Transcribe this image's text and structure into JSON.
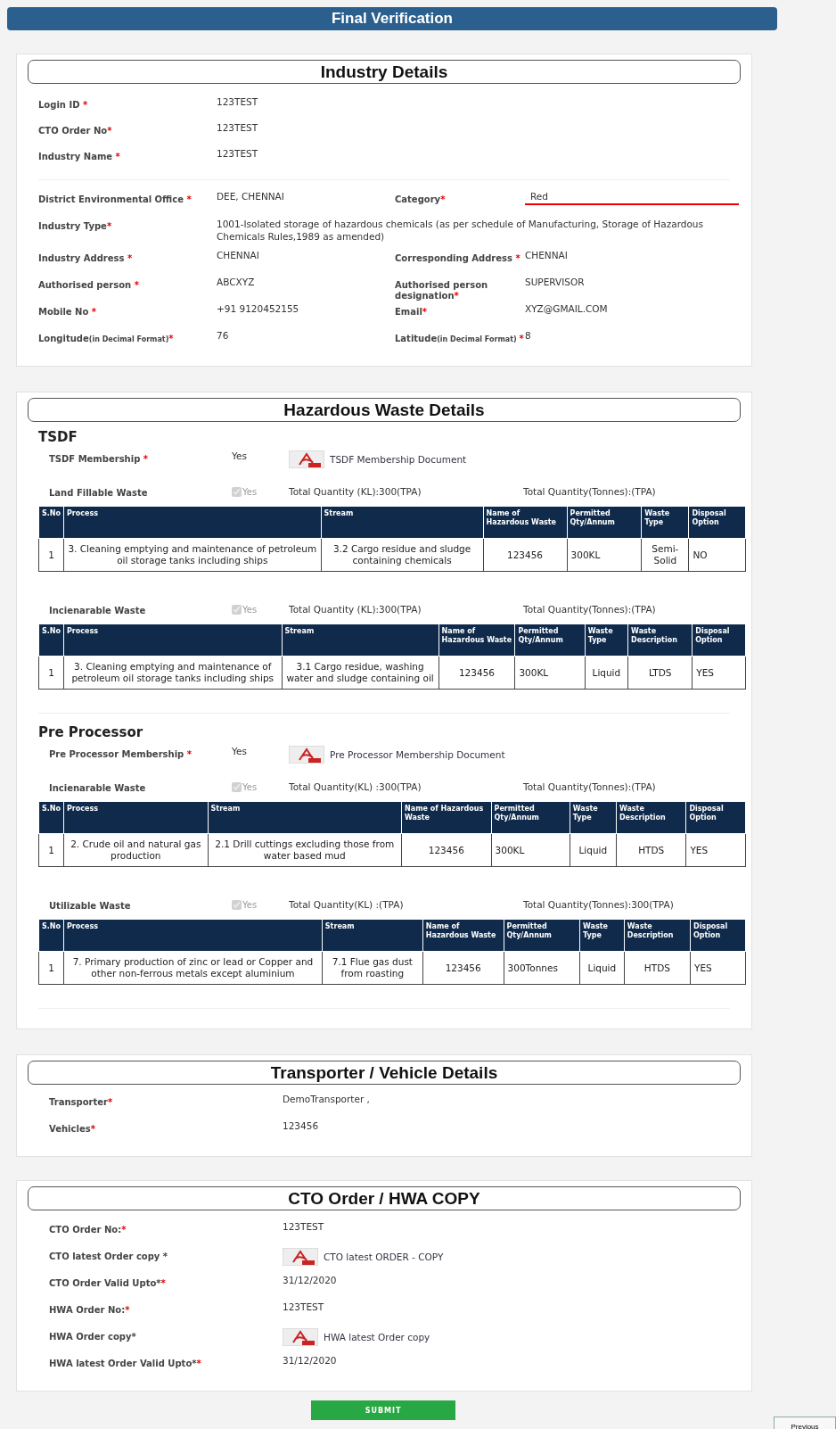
{
  "title": "Final Verification",
  "industry": {
    "title": "Industry Details",
    "top_fields": [
      {
        "label": "Login ID ",
        "mark": "*",
        "value": "123TEST"
      },
      {
        "label": "CTO Order No",
        "mark": "*",
        "value": "123TEST"
      },
      {
        "label": "Industry Name ",
        "mark": "*",
        "value": "123TEST"
      }
    ],
    "rows": [
      {
        "fields": [
          {
            "label": "District Environmental Office ",
            "mark": "*",
            "value": "DEE, CHENNAI",
            "kind": "text"
          },
          {
            "label": "Category",
            "mark": "*",
            "value": "Red",
            "kind": "underlined"
          }
        ]
      },
      {
        "fields": [
          {
            "label": "Industry Type",
            "mark": "*",
            "value": "1001-Isolated storage of hazardous chemicals (as per schedule of Manufacturing, Storage of Hazardous Chemicals Rules,1989 as amended)",
            "kind": "wide"
          }
        ]
      },
      {
        "fields": [
          {
            "label": "Industry Address ",
            "mark": "*",
            "value": "CHENNAI",
            "kind": "text"
          },
          {
            "label": "Corresponding Address ",
            "mark": "*",
            "value": "CHENNAI",
            "kind": "text"
          }
        ]
      },
      {
        "fields": [
          {
            "label": "Authorised person ",
            "mark": "*",
            "value": "ABCXYZ",
            "kind": "text"
          },
          {
            "label": "Authorised person designation",
            "mark": "*",
            "value": "SUPERVISOR",
            "kind": "text"
          }
        ]
      },
      {
        "fields": [
          {
            "label": "Mobile No ",
            "mark": "*",
            "value": "+91 9120452155",
            "kind": "text"
          },
          {
            "label": "Email",
            "mark": "*",
            "value": "XYZ@GMAIL.COM",
            "kind": "text"
          }
        ]
      },
      {
        "fields": [
          {
            "label": "Longitude",
            "note": "(in Decimal Format)",
            "mark": "*",
            "value": "76",
            "kind": "text"
          },
          {
            "label": "Latitude",
            "note": "(in Decimal Format) ",
            "mark": "*",
            "value": "8",
            "kind": "text"
          }
        ]
      }
    ]
  },
  "hazardous": {
    "title": "Hazardous Waste Details",
    "groups": [
      {
        "heading": "TSDF",
        "membership": {
          "label": "TSDF Membership ",
          "mark": "*",
          "value": "Yes",
          "document": "TSDF Membership Document"
        },
        "wastes": [
          {
            "label": "Land Fillable Waste",
            "checked": true,
            "check_label": "Yes",
            "qty_kl": "Total Quantity (KL):300(TPA)",
            "qty_tonnes": "Total Quantity(Tonnes):(TPA)",
            "columns": [
              "S.No",
              "Process",
              "Stream",
              "Name of Hazardous Waste",
              "Permitted Qty/Annum",
              "Waste Type",
              "Disposal Option"
            ],
            "rows": [
              [
                "1",
                "3. Cleaning emptying and maintenance of petroleum oil storage tanks including ships",
                "3.2 Cargo residue and sludge containing chemicals",
                "123456",
                "300KL",
                "Semi-Solid",
                "NO"
              ]
            ]
          },
          {
            "label": "Incienarable Waste",
            "checked": true,
            "check_label": "Yes",
            "qty_kl": "Total Quantity (KL):300(TPA)",
            "qty_tonnes": "Total Quantity(Tonnes):(TPA)",
            "columns": [
              "S.No",
              "Process",
              "Stream",
              "Name of Hazardous Waste",
              "Permitted Qty/Annum",
              "Waste Type",
              "Waste Description",
              "Disposal Option"
            ],
            "rows": [
              [
                "1",
                "3. Cleaning emptying and maintenance of petroleum oil storage tanks including ships",
                "3.1 Cargo residue, washing water and sludge containing oil",
                "123456",
                "300KL",
                "Liquid",
                "LTDS",
                "YES"
              ]
            ]
          }
        ]
      },
      {
        "heading": "Pre Processor",
        "membership": {
          "label": "Pre Processor Membership ",
          "mark": "*",
          "value": "Yes",
          "document": "Pre Processor Membership Document"
        },
        "wastes": [
          {
            "label": "Incienarable Waste",
            "checked": true,
            "check_label": "Yes",
            "qty_kl": "Total Quantity(KL) :300(TPA)",
            "qty_tonnes": "Total Quantity(Tonnes):(TPA)",
            "columns": [
              "S.No",
              "Process",
              "Stream",
              "Name of Hazardous Waste",
              "Permitted Qty/Annum",
              "Waste Type",
              "Waste Description",
              "Disposal Option"
            ],
            "rows": [
              [
                "1",
                "2. Crude oil and natural gas production",
                "2.1 Drill cuttings excluding those from water based mud",
                "123456",
                "300KL",
                "Liquid",
                "HTDS",
                "YES"
              ]
            ]
          },
          {
            "label": "Utilizable Waste",
            "checked": true,
            "check_label": "Yes",
            "qty_kl": "Total Quantity(KL) :(TPA)",
            "qty_tonnes": "Total Quantity(Tonnes):300(TPA)",
            "columns": [
              "S.No",
              "Process",
              "Stream",
              "Name of Hazardous Waste",
              "Permitted Qty/Annum",
              "Waste Type",
              "Waste Description",
              "Disposal Option"
            ],
            "rows": [
              [
                "1",
                "7. Primary production of zinc or lead or Copper and other non-ferrous metals except aluminium",
                "7.1 Flue gas dust from roasting",
                "123456",
                "300Tonnes",
                "Liquid",
                "HTDS",
                "YES"
              ]
            ]
          }
        ]
      }
    ]
  },
  "transporter": {
    "title": "Transporter / Vehicle Details",
    "fields": [
      {
        "label": "Transporter",
        "mark": "*",
        "value": "DemoTransporter ,",
        "kind": "text"
      },
      {
        "label": "Vehicles",
        "mark": "*",
        "value": "123456",
        "kind": "text"
      }
    ]
  },
  "cto": {
    "title": "CTO Order / HWA COPY",
    "fields": [
      {
        "label": "CTO Order No:",
        "mark": "*",
        "value": "123TEST",
        "kind": "text"
      },
      {
        "label": "CTO latest Order copy *",
        "value": "CTO latest ORDER - COPY",
        "kind": "document"
      },
      {
        "label": "CTO Order Valid Upto*",
        "mark": "*",
        "value": "31/12/2020",
        "kind": "text"
      },
      {
        "label": "HWA Order No:",
        "mark": "*",
        "value": "123TEST",
        "kind": "text"
      },
      {
        "label": "HWA Order copy*",
        "value": "HWA latest Order copy",
        "kind": "document"
      },
      {
        "label": "HWA latest Order Valid Upto*",
        "mark": "*",
        "value": "31/12/2020",
        "kind": "text"
      }
    ]
  },
  "submit_button": "SUBMIT",
  "previous_button": "Previous"
}
